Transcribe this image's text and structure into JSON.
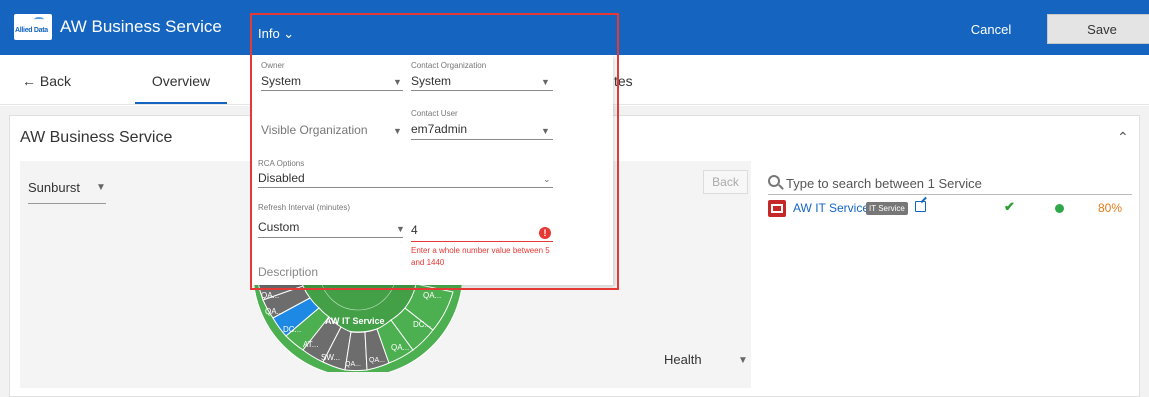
{
  "header": {
    "logo_text": "Allied Data",
    "title": "AW Business Service",
    "cancel_label": "Cancel",
    "save_label": "Save",
    "brand_color": "#1565c0"
  },
  "nav": {
    "back_label": "← Back",
    "tabs": [
      {
        "label": "Overview",
        "active": true
      },
      {
        "label": "tes"
      }
    ]
  },
  "card": {
    "title": "AW Business Service",
    "collapse_icon": "chevron-up-icon"
  },
  "viz": {
    "view_select": "Sunburst",
    "back_label": "Back",
    "color_by_select": "Health",
    "center_label": "AW IT Service",
    "segments": [
      "QA...",
      "QA...",
      "QA...",
      "DC...",
      "DC...",
      "AT...",
      "SW...",
      "QA...",
      "QA...",
      "QA...",
      "QA..."
    ]
  },
  "search": {
    "placeholder": "Type to search between 1 Service"
  },
  "services": [
    {
      "name": "AW IT Service",
      "badge": "IT Service",
      "health": "check",
      "status_color": "#2ea84a",
      "availability": "80%"
    }
  ],
  "info": {
    "title": "Info ⌄",
    "owner": {
      "label": "Owner",
      "value": "System"
    },
    "contact_org": {
      "label": "Contact Organization",
      "value": "System"
    },
    "visible_org": {
      "label": "Visible Organization",
      "value": ""
    },
    "contact_user": {
      "label": "Contact User",
      "value": "em7admin"
    },
    "rca": {
      "label": "RCA Options",
      "value": "Disabled"
    },
    "refresh": {
      "label": "Refresh Interval (minutes)",
      "value": "Custom",
      "custom_value": "4",
      "error": "Enter a whole number value between 5 and 1440"
    },
    "description_label": "Description"
  }
}
